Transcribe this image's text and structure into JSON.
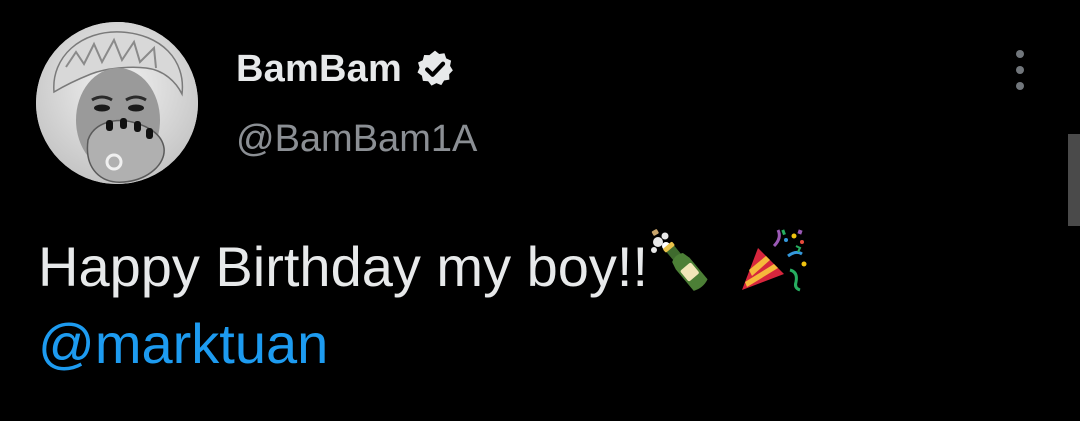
{
  "author": {
    "display_name": "BamBam",
    "handle": "@BamBam1A",
    "verified": true,
    "avatar": "profile-photo"
  },
  "tweet": {
    "text": "Happy Birthday my boy!!",
    "emojis": [
      "bottle-with-popping-cork-icon",
      "party-popper-icon"
    ],
    "mention": "@marktuan"
  },
  "icons": {
    "verified": "verified-badge-icon",
    "more": "more-vertical-icon"
  },
  "colors": {
    "background": "#000000",
    "text": "#e7e9ea",
    "secondary_text": "#8b8f94",
    "link": "#1d9bf0"
  }
}
